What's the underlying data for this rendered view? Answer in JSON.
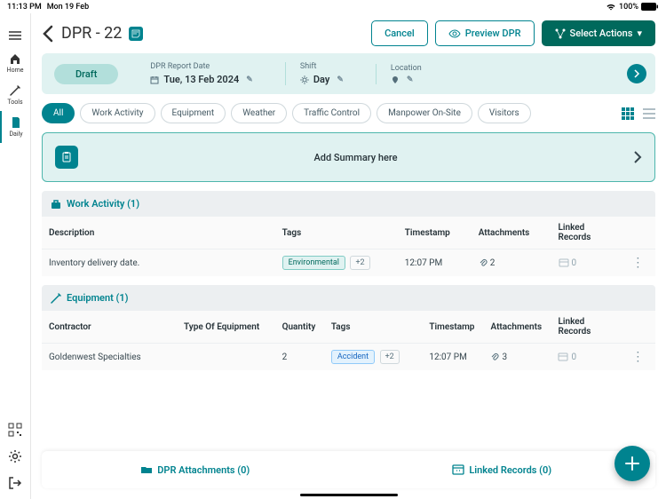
{
  "status": {
    "time": "11:13 PM",
    "date": "Mon 19 Feb",
    "battery": "100%"
  },
  "sidebar": {
    "items": [
      {
        "label": "Home"
      },
      {
        "label": "Tools"
      },
      {
        "label": "Daily"
      }
    ]
  },
  "header": {
    "title": "DPR - 22",
    "cancel": "Cancel",
    "preview": "Preview DPR",
    "actions": "Select Actions"
  },
  "info": {
    "status": "Draft",
    "dateLabel": "DPR Report Date",
    "dateValue": "Tue, 13 Feb 2024",
    "shiftLabel": "Shift",
    "shiftValue": "Day",
    "locationLabel": "Location"
  },
  "filters": [
    "All",
    "Work Activity",
    "Equipment",
    "Weather",
    "Traffic Control",
    "Manpower On-Site",
    "Visitors"
  ],
  "summary": {
    "placeholder": "Add Summary here"
  },
  "sections": {
    "work": {
      "title": "Work Activity (1)",
      "columns": [
        "Description",
        "Tags",
        "Timestamp",
        "Attachments",
        "Linked Records"
      ],
      "rows": [
        {
          "description": "Inventory delivery date.",
          "tag": "Environmental",
          "more": "+2",
          "timestamp": "12:07 PM",
          "attachments": "2",
          "linked": "0"
        }
      ]
    },
    "equipment": {
      "title": "Equipment (1)",
      "columns": [
        "Contractor",
        "Type Of Equipment",
        "Quantity",
        "Tags",
        "Timestamp",
        "Attachments",
        "Linked Records"
      ],
      "rows": [
        {
          "contractor": "Goldenwest Specialties",
          "type": "",
          "quantity": "2",
          "tag": "Accident",
          "more": "+2",
          "timestamp": "12:07 PM",
          "attachments": "3",
          "linked": "0"
        }
      ]
    }
  },
  "bottom": {
    "attachments": "DPR Attachments (0)",
    "linked": "Linked Records (0)"
  }
}
